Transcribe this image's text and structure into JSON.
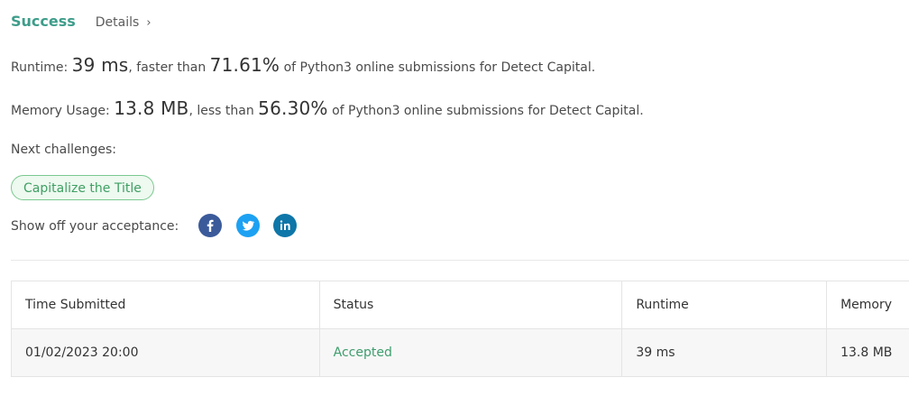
{
  "header": {
    "status": "Success",
    "details_label": "Details",
    "details_chevron": "›"
  },
  "runtime": {
    "label": "Runtime:",
    "value": "39 ms",
    "middle": ", faster than",
    "percent": "71.61%",
    "suffix": "of Python3 online submissions for Detect Capital."
  },
  "memory": {
    "label": "Memory Usage:",
    "value": "13.8 MB",
    "middle": ", less than",
    "percent": "56.30%",
    "suffix": "of Python3 online submissions for Detect Capital."
  },
  "next": {
    "label": "Next challenges:",
    "challenge": "Capitalize the Title"
  },
  "share": {
    "label": "Show off your acceptance:",
    "icons": [
      "facebook-icon",
      "twitter-icon",
      "linkedin-icon"
    ]
  },
  "table": {
    "headers": [
      "Time Submitted",
      "Status",
      "Runtime",
      "Memory"
    ],
    "rows": [
      {
        "time": "01/02/2023 20:00",
        "status": "Accepted",
        "runtime": "39 ms",
        "memory": "13.8 MB"
      }
    ]
  },
  "colors": {
    "success": "#3e9d8a",
    "accepted": "#3e9d6e",
    "facebook": "#3b5a9a",
    "twitter": "#1da1f2",
    "linkedin": "#0e76a8"
  }
}
